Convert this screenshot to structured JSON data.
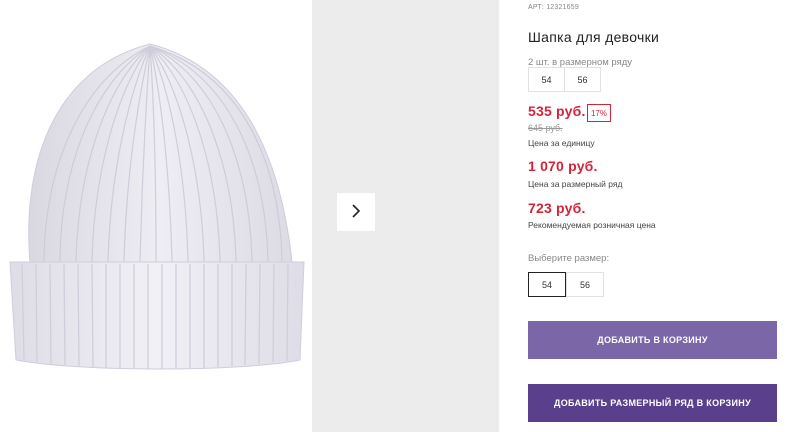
{
  "product": {
    "article": "АРТ: 12321659",
    "title": "Шапка для девочки"
  },
  "series": {
    "label": "2 шт. в размерном ряду",
    "sizes": [
      "54",
      "56"
    ]
  },
  "pricing": {
    "unit_price": "535 руб.",
    "discount_badge": "17%",
    "old_price": "645 руб.",
    "unit_caption": "Цена за единицу",
    "series_price": "1 070 руб.",
    "series_caption": "Цена за размерный ряд",
    "rrp_price": "723 руб.",
    "rrp_caption": "Рекомендуемая розничная цена"
  },
  "size_picker": {
    "label": "Выберите размер:",
    "options": [
      "54",
      "56"
    ],
    "selected": "54"
  },
  "actions": {
    "add_to_cart": "ДОБАВИТЬ В КОРЗИНУ",
    "add_series_to_cart": "ДОБАВИТЬ РАЗМЕРНЫЙ РЯД В КОРЗИНУ"
  },
  "gallery": {
    "next_icon": "chevron-right-icon",
    "image_subject": "knit beanie hat"
  },
  "colors": {
    "price_red": "#d4243a",
    "button_light_purple": "#7b67a8",
    "button_dark_purple": "#5a3f8c",
    "thumb_panel": "#ececec"
  }
}
